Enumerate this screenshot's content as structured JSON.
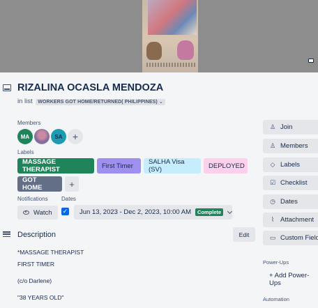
{
  "card": {
    "title": "RIZALINA OCASLA MENDOZA",
    "in_list_prefix": "in list",
    "list_name": "WORKERS GOT HOME/RETURNED( PHILIPPINES)"
  },
  "members": {
    "heading": "Members",
    "avatars": [
      "MA",
      "",
      "SA"
    ],
    "add": "+"
  },
  "labels": {
    "heading": "Labels",
    "items": [
      {
        "text": "MASSAGE THERAPIST",
        "bg": "#1f845a",
        "fg": "#ffffff"
      },
      {
        "text": "First Timer",
        "bg": "#9f8fef",
        "fg": "#172b4d"
      },
      {
        "text": "SALHA Visa (SV)",
        "bg": "#c6edfb",
        "fg": "#172b4d"
      },
      {
        "text": "DEPLOYED",
        "bg": "#fdd0ec",
        "fg": "#172b4d"
      },
      {
        "text": "GOT HOME",
        "bg": "#626f86",
        "fg": "#ffffff"
      }
    ],
    "add": "+"
  },
  "notifications": {
    "heading": "Notifications",
    "watch_label": "Watch"
  },
  "dates": {
    "heading": "Dates",
    "checked": "✓",
    "range": "Jun 13, 2023 - Dec 2, 2023, 10:00 AM",
    "status": "Complete"
  },
  "description": {
    "heading": "Description",
    "edit_label": "Edit",
    "lines": [
      "*MASSAGE THERAPIST",
      "FIRST TIMER",
      "(c/o Darlene)",
      "\"38 YEARS OLD\""
    ]
  },
  "sidebar": {
    "buttons": [
      {
        "label": "Join",
        "icon": "person-icon"
      },
      {
        "label": "Members",
        "icon": "person-icon"
      },
      {
        "label": "Labels",
        "icon": "tag-icon"
      },
      {
        "label": "Checklist",
        "icon": "checklist-icon"
      },
      {
        "label": "Dates",
        "icon": "clock-icon"
      },
      {
        "label": "Attachment",
        "icon": "paperclip-icon"
      },
      {
        "label": "Custom Fields",
        "icon": "custom-fields-icon"
      }
    ],
    "powerups_heading": "Power-Ups",
    "add_powerup": "+ Add Power-Ups",
    "automation_heading": "Automation"
  }
}
